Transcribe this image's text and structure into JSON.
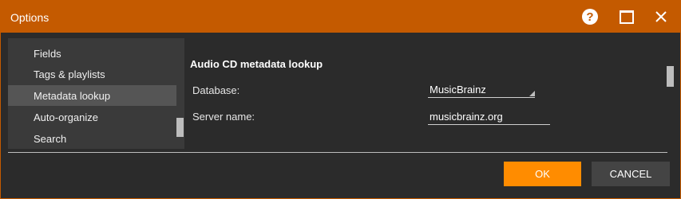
{
  "window": {
    "title": "Options",
    "help_icon": "?",
    "accent_color": "#c45a00"
  },
  "sidebar": {
    "items": [
      {
        "label": "Fields",
        "selected": false
      },
      {
        "label": "Tags & playlists",
        "selected": false
      },
      {
        "label": "Metadata lookup",
        "selected": true
      },
      {
        "label": "Auto-organize",
        "selected": false
      },
      {
        "label": "Search",
        "selected": false
      }
    ]
  },
  "content": {
    "section_title": "Audio CD metadata lookup",
    "database": {
      "label": "Database:",
      "value": "MusicBrainz"
    },
    "server": {
      "label": "Server name:",
      "value": "musicbrainz.org"
    }
  },
  "footer": {
    "ok_label": "OK",
    "cancel_label": "CANCEL",
    "ok_color": "#ff8c00"
  }
}
